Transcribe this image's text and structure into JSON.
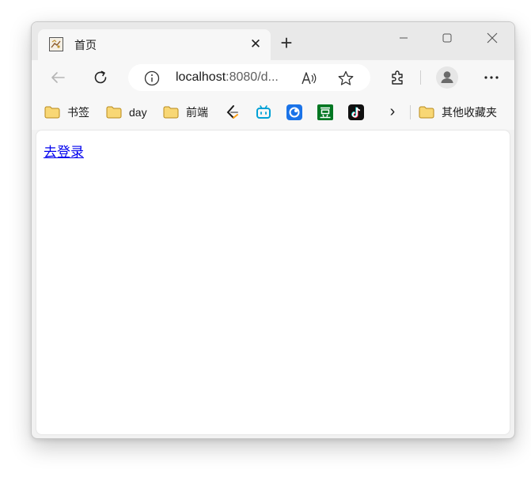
{
  "tab": {
    "title": "首页",
    "favicon": "tomcat-favicon-icon",
    "close": "✕"
  },
  "new_tab": "+",
  "window_controls": [
    "minimize-icon",
    "maximize-icon",
    "close-icon"
  ],
  "address_bar": {
    "host": "localhost",
    "rest": ":8080/d..."
  },
  "bookmarks": {
    "items": [
      {
        "label": "书签",
        "icon": "folder-icon"
      },
      {
        "label": "day",
        "icon": "folder-icon"
      },
      {
        "label": "前端",
        "icon": "folder-icon"
      }
    ],
    "sites": [
      "leetcode-icon",
      "bilibili-icon",
      "blue-app-icon",
      "douban-icon",
      "tiktok-icon"
    ],
    "overflow": "›",
    "other": {
      "label": "其他收藏夹",
      "icon": "folder-icon"
    }
  },
  "page": {
    "link": "去登录"
  },
  "colors": {
    "link": "#0000ee",
    "folder": "#f5c542",
    "bilibili": "#00a1d6",
    "douban": "#007722",
    "blue_app": "#1a73e8"
  }
}
